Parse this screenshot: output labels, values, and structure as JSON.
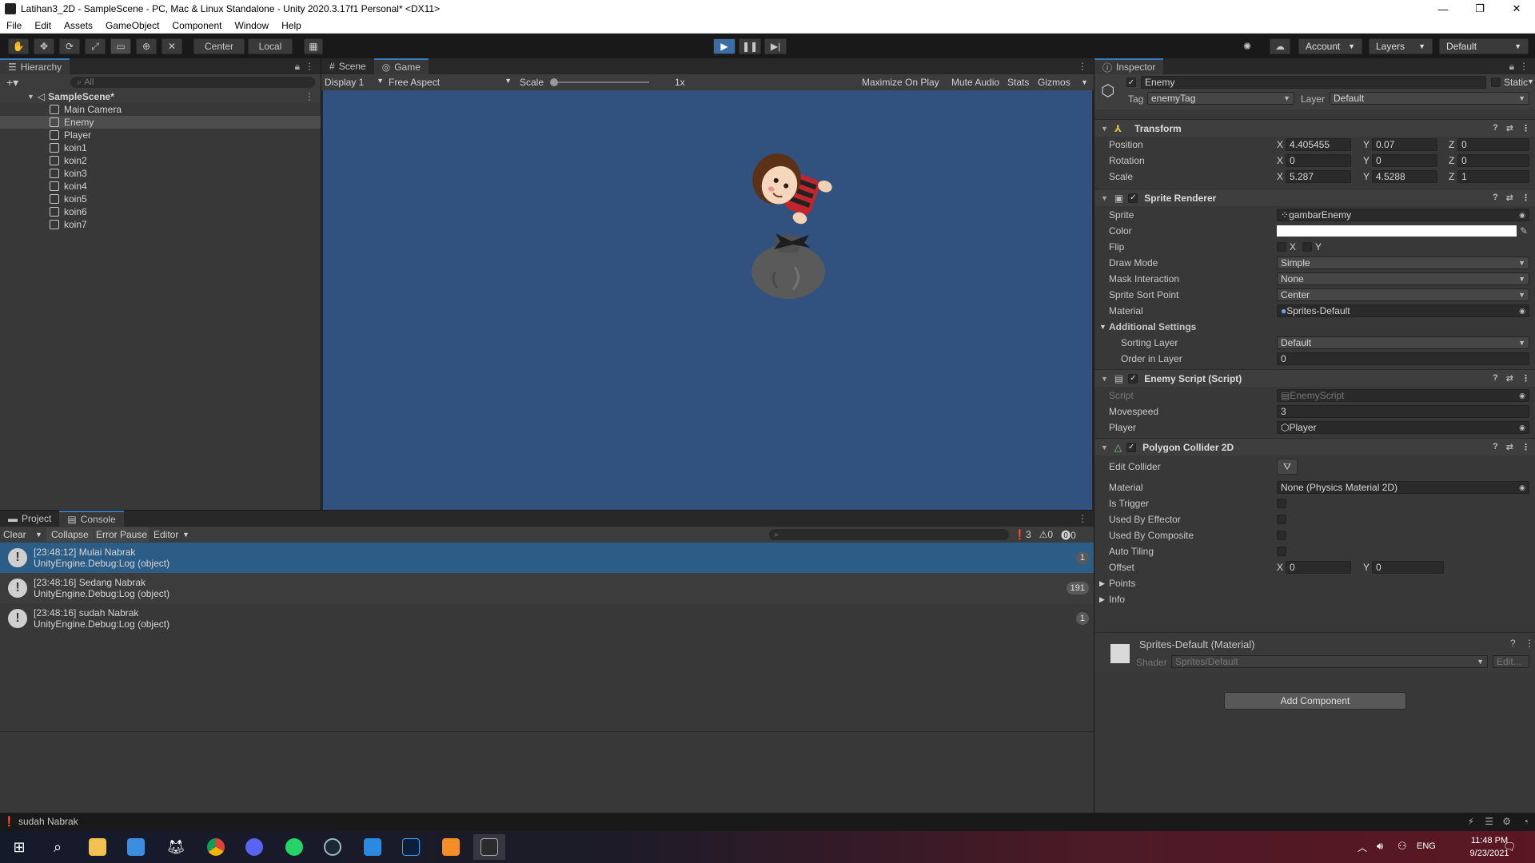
{
  "window": {
    "title": "Latihan3_2D - SampleScene - PC, Mac & Linux Standalone - Unity 2020.3.17f1 Personal* <DX11>",
    "controls": [
      "—",
      "❐",
      "✕"
    ]
  },
  "menu": [
    "File",
    "Edit",
    "Assets",
    "GameObject",
    "Component",
    "Window",
    "Help"
  ],
  "toolbar": {
    "pivot_center": "Center",
    "pivot_local": "Local",
    "account": "Account",
    "layers": "Layers",
    "layout": "Default"
  },
  "hierarchy": {
    "tab": "Hierarchy",
    "search_placeholder": "All",
    "scene": "SampleScene*",
    "items": [
      "Main Camera",
      "Enemy",
      "Player",
      "koin1",
      "koin2",
      "koin3",
      "koin4",
      "koin5",
      "koin6",
      "koin7"
    ],
    "selected": "Enemy"
  },
  "game": {
    "tabs": [
      "Scene",
      "Game"
    ],
    "active_tab": "Game",
    "display": "Display 1",
    "aspect": "Free Aspect",
    "scale_label": "Scale",
    "scale_value": "1x",
    "maximize": "Maximize On Play",
    "mute": "Mute Audio",
    "stats": "Stats",
    "gizmos": "Gizmos",
    "background": "#31517f"
  },
  "console": {
    "tabs": [
      "Project",
      "Console"
    ],
    "active_tab": "Console",
    "buttons": {
      "clear": "Clear",
      "collapse": "Collapse",
      "error_pause": "Error Pause",
      "editor": "Editor"
    },
    "counts": {
      "info": "3",
      "warn": "0",
      "error": "0"
    },
    "logs": [
      {
        "line1": "[23:48:12] Mulai Nabrak",
        "line2": "UnityEngine.Debug:Log (object)",
        "count": "1",
        "selected": true
      },
      {
        "line1": "[23:48:16] Sedang Nabrak",
        "line2": "UnityEngine.Debug:Log (object)",
        "count": "191",
        "selected": false
      },
      {
        "line1": "[23:48:16] sudah Nabrak",
        "line2": "UnityEngine.Debug:Log (object)",
        "count": "1",
        "selected": false
      }
    ]
  },
  "inspector": {
    "tab": "Inspector",
    "object_name": "Enemy",
    "static": "Static",
    "tag_label": "Tag",
    "tag": "enemyTag",
    "layer_label": "Layer",
    "layer": "Default",
    "transform": {
      "title": "Transform",
      "position_label": "Position",
      "position": {
        "x": "4.405455",
        "y": "0.07",
        "z": "0"
      },
      "rotation_label": "Rotation",
      "rotation": {
        "x": "0",
        "y": "0",
        "z": "0"
      },
      "scale_label": "Scale",
      "scale": {
        "x": "5.287",
        "y": "4.5288",
        "z": "1"
      }
    },
    "sprite_renderer": {
      "title": "Sprite Renderer",
      "sprite_label": "Sprite",
      "sprite": "gambarEnemy",
      "color_label": "Color",
      "flip_label": "Flip",
      "flip_x": "X",
      "flip_y": "Y",
      "draw_mode_label": "Draw Mode",
      "draw_mode": "Simple",
      "mask_label": "Mask Interaction",
      "mask": "None",
      "sort_point_label": "Sprite Sort Point",
      "sort_point": "Center",
      "material_label": "Material",
      "material": "Sprites-Default",
      "additional": "Additional Settings",
      "sorting_layer_label": "Sorting Layer",
      "sorting_layer": "Default",
      "order_label": "Order in Layer",
      "order": "0"
    },
    "enemy_script": {
      "title": "Enemy Script (Script)",
      "script_label": "Script",
      "script": "EnemyScript",
      "movespeed_label": "Movespeed",
      "movespeed": "3",
      "player_label": "Player",
      "player": "Player"
    },
    "polygon_collider": {
      "title": "Polygon Collider 2D",
      "edit_label": "Edit Collider",
      "material_label": "Material",
      "material": "None (Physics Material 2D)",
      "trigger_label": "Is Trigger",
      "effector_label": "Used By Effector",
      "composite_label": "Used By Composite",
      "tiling_label": "Auto Tiling",
      "offset_label": "Offset",
      "offset": {
        "x": "0",
        "y": "0"
      },
      "points_label": "Points",
      "info_label": "Info"
    },
    "material_preview": {
      "title": "Sprites-Default (Material)",
      "shader_label": "Shader",
      "shader": "Sprites/Default",
      "edit": "Edit..."
    },
    "add_component": "Add Component"
  },
  "status": {
    "message": "sudah Nabrak"
  },
  "taskbar": {
    "tray_lang": "ENG",
    "time": "11:48 PM",
    "date": "9/23/2021"
  }
}
